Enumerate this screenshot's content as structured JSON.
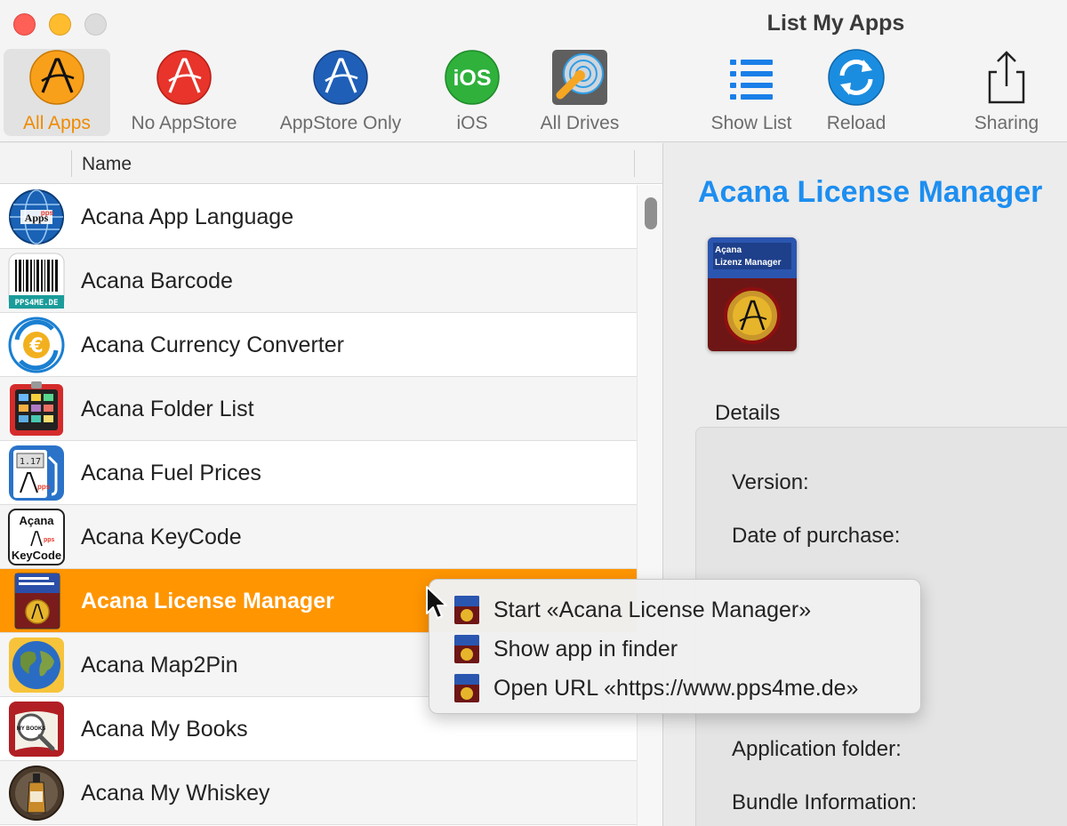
{
  "window": {
    "title": "List My Apps"
  },
  "toolbar": {
    "items": [
      {
        "label": "All Apps",
        "icon": "acana-a-orange-icon"
      },
      {
        "label": "No AppStore",
        "icon": "acana-a-red-icon"
      },
      {
        "label": "AppStore Only",
        "icon": "appstore-a-blue-icon"
      },
      {
        "label": "iOS",
        "icon": "ios-green-icon"
      },
      {
        "label": "All Drives",
        "icon": "drive-icon"
      },
      {
        "label": "Show List",
        "icon": "list-icon"
      },
      {
        "label": "Reload",
        "icon": "reload-icon"
      },
      {
        "label": "Sharing",
        "icon": "share-icon"
      }
    ]
  },
  "list": {
    "header": "Name",
    "rows": [
      {
        "name": "Acana App Language",
        "icon": "globe-icon"
      },
      {
        "name": "Acana Barcode",
        "icon": "barcode-icon"
      },
      {
        "name": "Acana Currency Converter",
        "icon": "euro-icon"
      },
      {
        "name": "Acana Folder List",
        "icon": "folder-list-icon"
      },
      {
        "name": "Acana Fuel Prices",
        "icon": "fuel-pump-icon"
      },
      {
        "name": "Acana KeyCode",
        "icon": "keycode-icon"
      },
      {
        "name": "Acana License Manager",
        "icon": "license-manager-icon",
        "selected": true
      },
      {
        "name": "Acana Map2Pin",
        "icon": "world-map-icon"
      },
      {
        "name": "Acana My Books",
        "icon": "books-icon"
      },
      {
        "name": "Acana My Whiskey",
        "icon": "whiskey-icon"
      }
    ]
  },
  "detail": {
    "title": "Acana License Manager",
    "icon_lines": [
      "Açana",
      "Lizenz Manager"
    ],
    "details_label": "Details",
    "fields": {
      "version": "Version:",
      "purchase": "Date of purchase:",
      "folder": "Application folder:",
      "bundle": "Bundle Information:"
    }
  },
  "context_menu": {
    "items": [
      "Start «Acana License Manager»",
      "Show app in finder",
      "Open URL «https://www.pps4me.de»"
    ]
  },
  "icon_texts": {
    "apps": "Apps",
    "pps": "pps",
    "barcode_site": "PPS4ME.DE",
    "euro": "€",
    "fuel": "1.17",
    "keycode_top": "Açana",
    "keycode_bottom": "KeyCode",
    "books": "MY BOOKS",
    "ios": "iOS"
  },
  "colors": {
    "accent_orange": "#ff9500",
    "title_blue": "#1d8ef0",
    "tool_active_label": "#ef8a00"
  }
}
